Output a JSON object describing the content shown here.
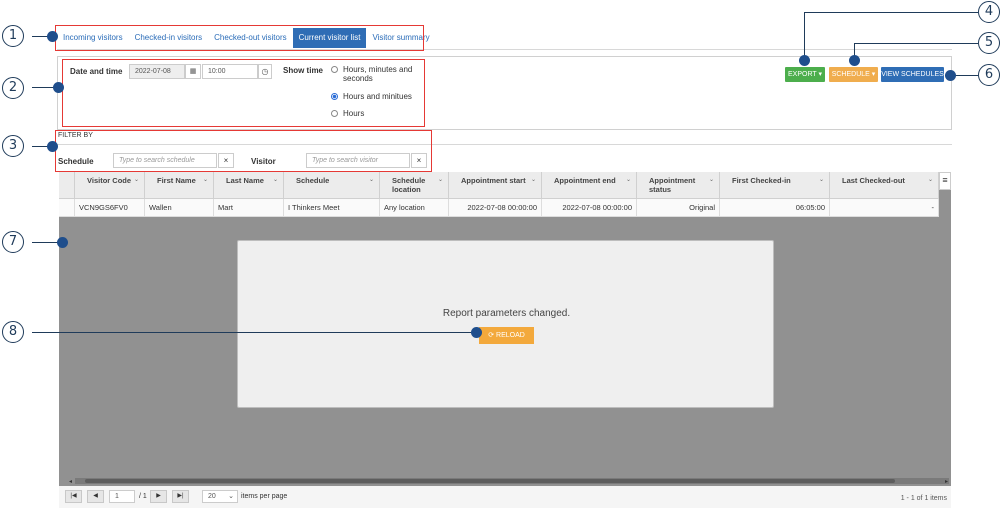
{
  "tabs": [
    "Incoming visitors",
    "Checked-in visitors",
    "Checked-out visitors",
    "Current visitor list",
    "Visitor summary"
  ],
  "active_tab": 3,
  "params": {
    "date_time_label": "Date and time",
    "date_value": "2022-07-08",
    "time_value": "10:00",
    "show_time_label": "Show time",
    "radio_options": [
      "Hours, minutes and seconds",
      "Hours and minitues",
      "Hours"
    ],
    "selected_radio": 1
  },
  "buttons": {
    "export": "EXPORT ▾",
    "schedule": "SCHEDULE ▾",
    "view_schedules": "VIEW SCHEDULES"
  },
  "colors": {
    "export": "#4cae4c",
    "schedule": "#f0ad4e",
    "view_schedules": "#2f6db5",
    "tab_active": "#2f6db5",
    "callout": "#1f3b5a",
    "highlight": "#e53935"
  },
  "filter": {
    "title": "FILTER BY",
    "schedule_label": "Schedule",
    "schedule_placeholder": "Type to search schedule",
    "visitor_label": "Visitor",
    "visitor_placeholder": "Type to search visitor",
    "clear": "×"
  },
  "table": {
    "columns": [
      "Visitor Code",
      "First Name",
      "Last Name",
      "Schedule",
      "Schedule location",
      "Appointment start",
      "Appointment end",
      "Appointment status",
      "First Checked-in",
      "Last Checked-out"
    ],
    "rows": [
      [
        "VCN9GS6FV0",
        "Wallen",
        "Mart",
        "I Thinkers Meet",
        "Any location",
        "2022-07-08 00:00:00",
        "2022-07-08 00:00:00",
        "Original",
        "06:05:00",
        "-"
      ]
    ]
  },
  "modal": {
    "message": "Report parameters changed.",
    "reload": "RELOAD"
  },
  "pager": {
    "page": "1",
    "of": "/ 1",
    "page_size": "20",
    "items_per_page": "items per page",
    "summary": "1 - 1 of 1 items"
  },
  "callouts": [
    "1",
    "2",
    "3",
    "4",
    "5",
    "6",
    "7",
    "8"
  ]
}
